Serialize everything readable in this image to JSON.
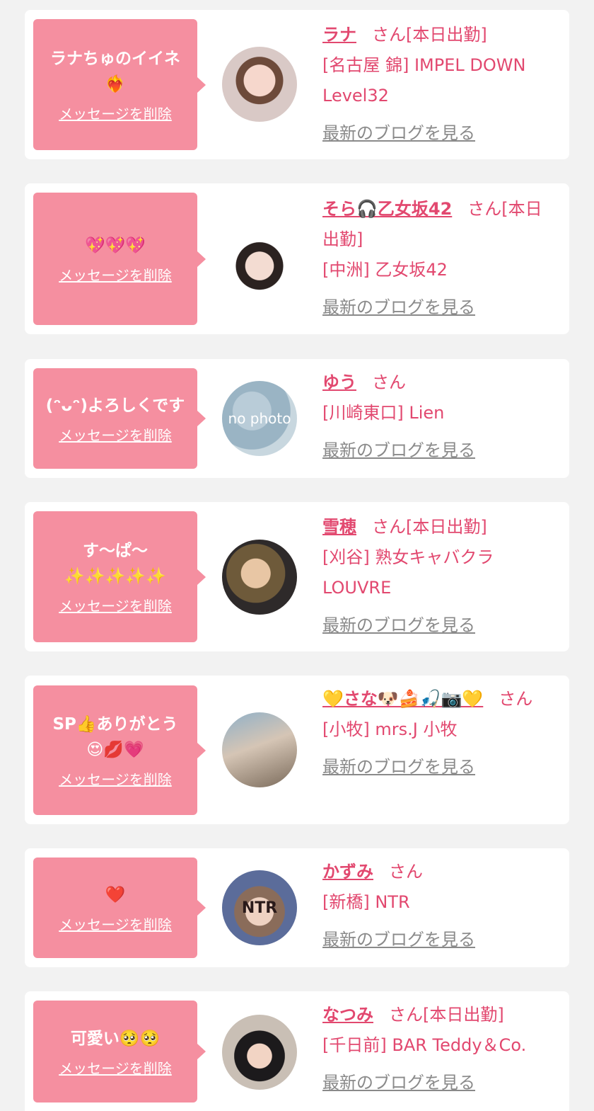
{
  "items": [
    {
      "message": "ラナちゅのイイネ\n❤️‍🔥",
      "delete_label": "メッセージを削除",
      "name": "ラナ",
      "honorific": "さん",
      "status": "[本日出勤]",
      "shop": "[名古屋 錦] IMPEL DOWN Level32",
      "blog_label": "最新のブログを見る",
      "avatar_text": ""
    },
    {
      "message": "💖💖💖",
      "delete_label": "メッセージを削除",
      "name": "そら🎧乙女坂42",
      "honorific": "さん",
      "status": "[本日出勤]",
      "shop": "[中洲] 乙女坂42",
      "blog_label": "最新のブログを見る",
      "avatar_text": ""
    },
    {
      "message": "(ᵔᴗᵔ)よろしくです",
      "delete_label": "メッセージを削除",
      "name": "ゆう",
      "honorific": "さん",
      "status": "",
      "shop": "[川崎東口] Lien",
      "blog_label": "最新のブログを見る",
      "avatar_text": "no photo"
    },
    {
      "message": "す〜ぱ〜\n✨✨✨✨✨",
      "delete_label": "メッセージを削除",
      "name": "雪穂",
      "honorific": "さん",
      "status": "[本日出勤]",
      "shop": "[刈谷] 熟女キャバクラ LOUVRE",
      "blog_label": "最新のブログを見る",
      "avatar_text": ""
    },
    {
      "message": "SP👍ありがとう\n😍💋💗",
      "delete_label": "メッセージを削除",
      "name": "💛さな🐶🍰🎣📷💛",
      "honorific": "さん",
      "status": "",
      "shop": "[小牧] mrs.J 小牧",
      "blog_label": "最新のブログを見る",
      "avatar_text": ""
    },
    {
      "message": "❤️",
      "delete_label": "メッセージを削除",
      "name": "かずみ",
      "honorific": "さん",
      "status": "",
      "shop": "[新橋] NTR",
      "blog_label": "最新のブログを見る",
      "avatar_text": "NTR"
    },
    {
      "message": "可愛い🥺🥺",
      "delete_label": "メッセージを削除",
      "name": "なつみ",
      "honorific": "さん",
      "status": "[本日出勤]",
      "shop": "[千日前] BAR Teddy＆Co.",
      "blog_label": "最新のブログを見る",
      "avatar_text": ""
    }
  ]
}
